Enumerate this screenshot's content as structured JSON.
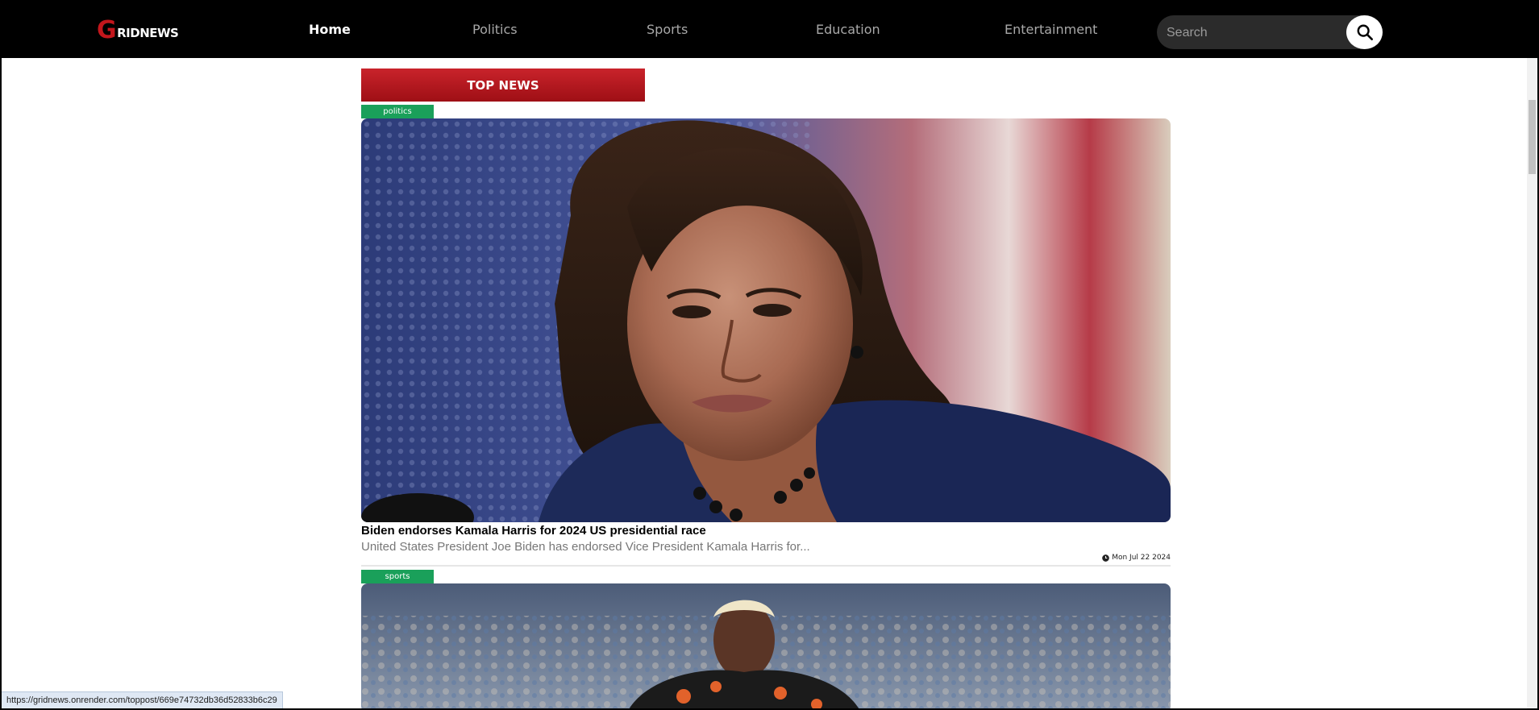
{
  "logo": {
    "g": "G",
    "rest": "RIDNEWS"
  },
  "nav": {
    "items": [
      {
        "label": "Home",
        "active": true
      },
      {
        "label": "Politics"
      },
      {
        "label": "Sports"
      },
      {
        "label": "Education"
      },
      {
        "label": "Entertainment"
      }
    ]
  },
  "search": {
    "placeholder": "Search",
    "icon": "search-icon"
  },
  "section_title": "TOP NEWS",
  "posts": [
    {
      "category": "politics",
      "headline": "Biden endorses Kamala Harris for 2024 US presidential race",
      "summary": "United States President Joe Biden has endorsed Vice President Kamala Harris for...",
      "date": "Mon Jul 22 2024"
    },
    {
      "category": "sports"
    }
  ],
  "status_url": "https://gridnews.onrender.com/toppost/669e74732db36d52833b6c29",
  "colors": {
    "header_bg": "#000000",
    "brand_red": "#c3161c",
    "tag_green": "#1aa05a"
  }
}
